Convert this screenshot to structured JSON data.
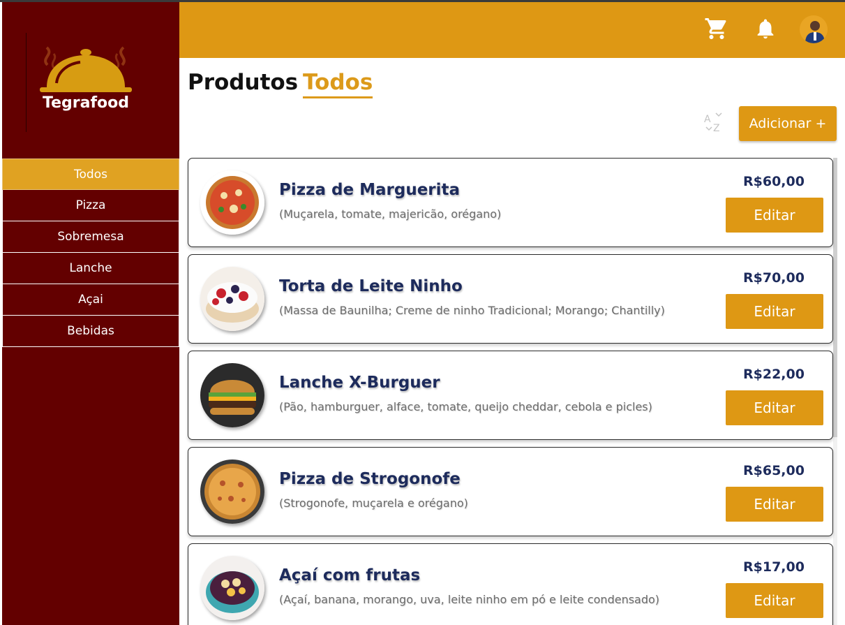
{
  "app": {
    "logo_text": "Tegrafood"
  },
  "sidebar": {
    "items": [
      {
        "label": "Todos",
        "active": true
      },
      {
        "label": "Pizza"
      },
      {
        "label": "Sobremesa"
      },
      {
        "label": "Lanche"
      },
      {
        "label": "Açai"
      },
      {
        "label": "Bebidas"
      }
    ]
  },
  "header": {
    "icons": [
      "cart-icon",
      "bell-icon",
      "avatar"
    ]
  },
  "page": {
    "title": "Produtos",
    "subtitle": "Todos",
    "add_button": "Adicionar +",
    "sort_icon": "sort-az-icon"
  },
  "products": [
    {
      "name": "Pizza de Marguerita",
      "description": "(Muçarela, tomate, majericão, orégano)",
      "price": "R$60,00",
      "edit_label": "Editar",
      "image": "pizza"
    },
    {
      "name": "Torta de Leite Ninho",
      "description": "(Massa de Baunilha; Creme de ninho Tradicional; Morango; Chantilly)",
      "price": "R$70,00",
      "edit_label": "Editar",
      "image": "cake"
    },
    {
      "name": "Lanche X-Burguer",
      "description": "(Pão, hamburguer, alface, tomate, queijo cheddar, cebola e picles)",
      "price": "R$22,00",
      "edit_label": "Editar",
      "image": "burger"
    },
    {
      "name": "Pizza de Strogonofe",
      "description": "(Strogonofe, muçarela e orégano)",
      "price": "R$65,00",
      "edit_label": "Editar",
      "image": "pizza2"
    },
    {
      "name": "Açaí com frutas",
      "description": "(Açaí, banana, morango, uva, leite ninho em pó e leite condensado)",
      "price": "R$17,00",
      "edit_label": "Editar",
      "image": "acai"
    }
  ],
  "colors": {
    "sidebar": "#630000",
    "accent": "#de9814",
    "text_dark": "#1d2b5c"
  }
}
